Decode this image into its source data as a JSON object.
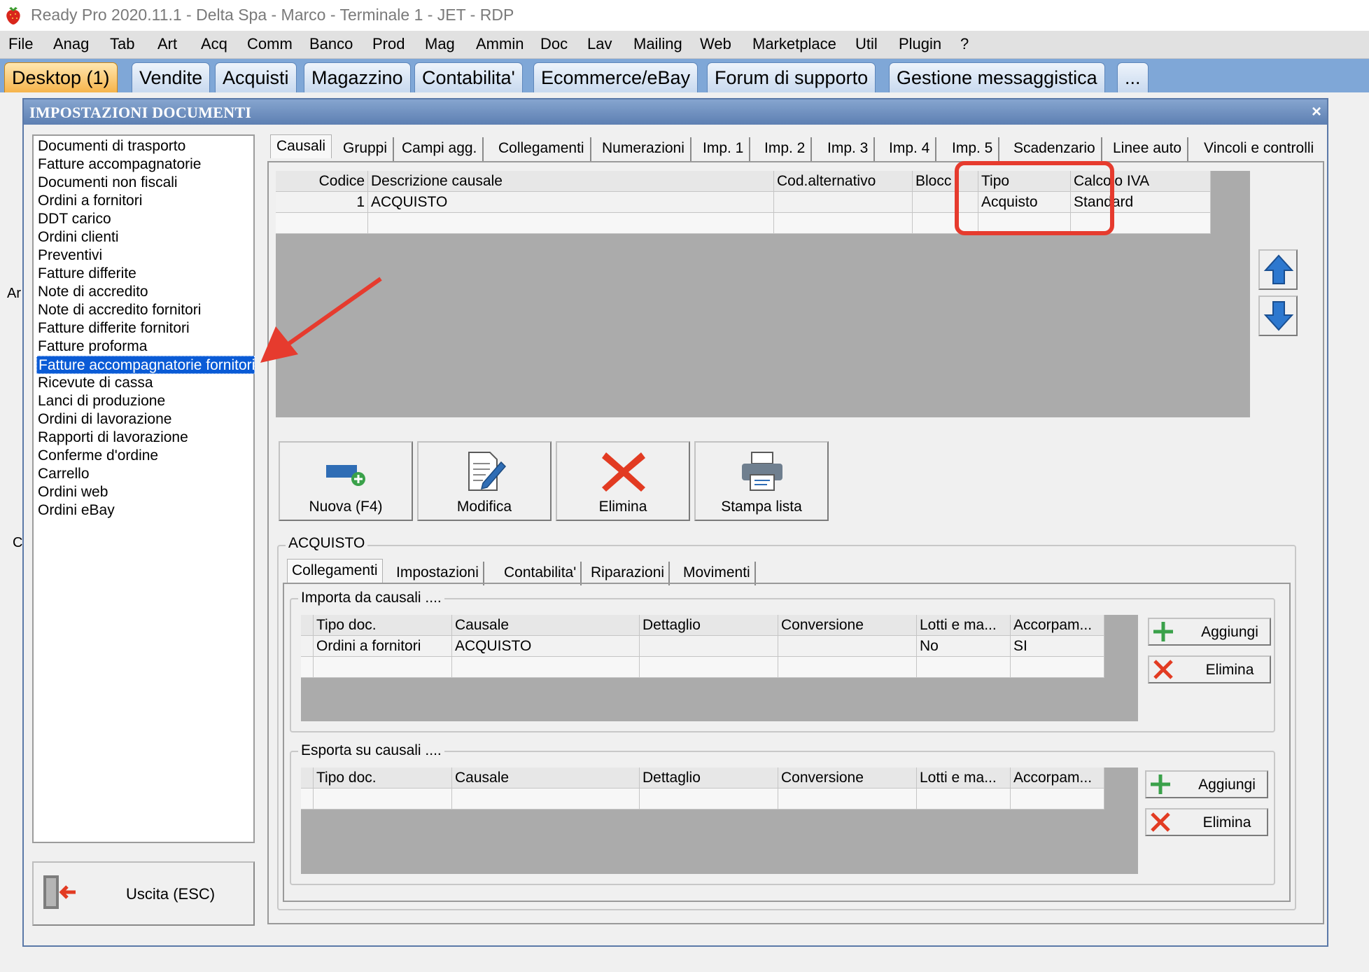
{
  "window": {
    "title": "Ready Pro 2020.11.1 - Delta Spa - Marco - Terminale 1 - JET - RDP",
    "icon": "strawberry-icon"
  },
  "menu": [
    "File",
    "Anag",
    "Tab",
    "Art",
    "Acq",
    "Comm",
    "Banco",
    "Prod",
    "Mag",
    "Ammin",
    "Doc",
    "Lav",
    "Mailing",
    "Web",
    "Marketplace",
    "Util",
    "Plugin",
    "?"
  ],
  "top_tabs": [
    "Desktop (1)",
    "Vendite",
    "Acquisti",
    "Magazzino",
    "Contabilita'",
    "Ecommerce/eBay",
    "Forum di supporto",
    "Gestione messaggistica",
    "..."
  ],
  "background_text": [
    "Ar",
    "C"
  ],
  "dialog": {
    "title": "IMPOSTAZIONI DOCUMENTI",
    "close": "×",
    "doc_types": [
      "Documenti di trasporto",
      "Fatture accompagnatorie",
      "Documenti non fiscali",
      "Ordini a fornitori",
      "DDT carico",
      "Ordini clienti",
      "Preventivi",
      "Fatture differite",
      "Note di accredito",
      "Note di accredito fornitori",
      "Fatture differite fornitori",
      "Fatture proforma",
      "Fatture accompagnatorie fornitori",
      "Ricevute di cassa",
      "Lanci di produzione",
      "Ordini di lavorazione",
      "Rapporti di lavorazione",
      "Conferme d'ordine",
      "Carrello",
      "Ordini web",
      "Ordini eBay"
    ],
    "selected_doc": "Fatture accompagnatorie fornitori",
    "exit_label": "Uscita (ESC)",
    "tabs": [
      "Causali",
      "Gruppi",
      "Campi agg.",
      "Collegamenti",
      "Numerazioni",
      "Imp. 1",
      "Imp. 2",
      "Imp. 3",
      "Imp. 4",
      "Imp. 5",
      "Scadenzario",
      "Linee auto",
      "Vincoli e controlli"
    ],
    "causali_grid": {
      "headers": [
        "Codice",
        "Descrizione causale",
        "Cod.alternativo",
        "Blocc",
        "Tipo",
        "Calcolo IVA"
      ],
      "rows": [
        [
          "1",
          "ACQUISTO",
          "",
          "",
          "Acquisto",
          "Standard"
        ]
      ]
    },
    "actions": {
      "new": "Nuova (F4)",
      "edit": "Modifica",
      "delete": "Elimina",
      "print": "Stampa lista"
    },
    "section_title": "ACQUISTO",
    "sub_tabs": [
      "Collegamenti",
      "Impostazioni",
      "Contabilita'",
      "Riparazioni",
      "Movimenti"
    ],
    "import_group": {
      "title": "Importa da causali ....",
      "headers": [
        "Tipo doc.",
        "Causale",
        "Dettaglio",
        "Conversione",
        "Lotti e ma...",
        "Accorpam..."
      ],
      "rows": [
        [
          "Ordini a fornitori",
          "ACQUISTO",
          "",
          "",
          "No",
          "SI"
        ]
      ],
      "add": "Aggiungi",
      "remove": "Elimina"
    },
    "export_group": {
      "title": "Esporta su causali ....",
      "headers": [
        "Tipo doc.",
        "Causale",
        "Dettaglio",
        "Conversione",
        "Lotti e ma...",
        "Accorpam..."
      ],
      "add": "Aggiungi",
      "remove": "Elimina"
    }
  },
  "colors": {
    "accent_tab": "#7fa7d7",
    "selection": "#0a5bd6",
    "annotation": "#e63b2e"
  }
}
